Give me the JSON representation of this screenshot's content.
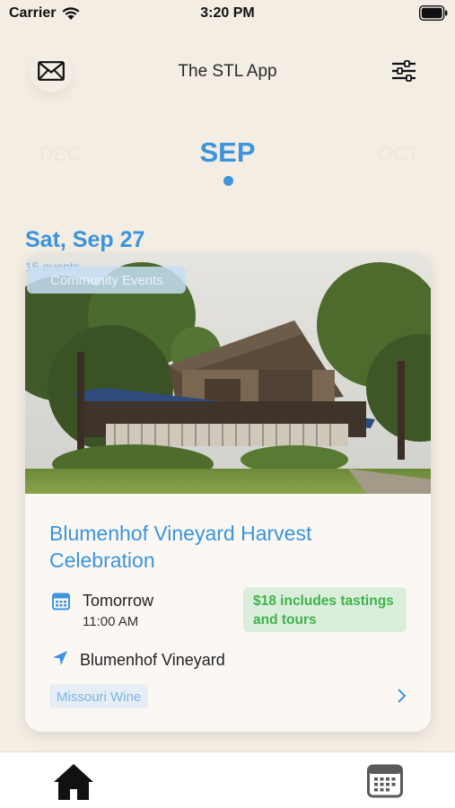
{
  "status_bar": {
    "carrier": "Carrier",
    "time": "3:20 PM",
    "icons": [
      "wifi-icon",
      "battery-icon"
    ]
  },
  "header": {
    "title": "The STL App",
    "left_icon": "mail-icon",
    "right_icon": "filter-icon"
  },
  "month_selector": {
    "previous": "DEC",
    "current": "SEP",
    "next": "OCT"
  },
  "day": {
    "heading": "Sat, Sep 27",
    "event_count": "15 events"
  },
  "event": {
    "category": "Community Events",
    "title": "Blumenhof Vineyard Harvest Celebration",
    "day": "Tomorrow",
    "time": "11:00 AM",
    "price": "$18 includes tastings and tours",
    "location": "Blumenhof Vineyard",
    "tag": "Missouri Wine"
  },
  "tab_bar": {
    "items": [
      "home-icon",
      "calendar-icon"
    ]
  },
  "colors": {
    "accent": "#3b94dd",
    "background": "#f3ede4",
    "price_text": "#3fb24a",
    "price_bg": "#dbeedc"
  }
}
